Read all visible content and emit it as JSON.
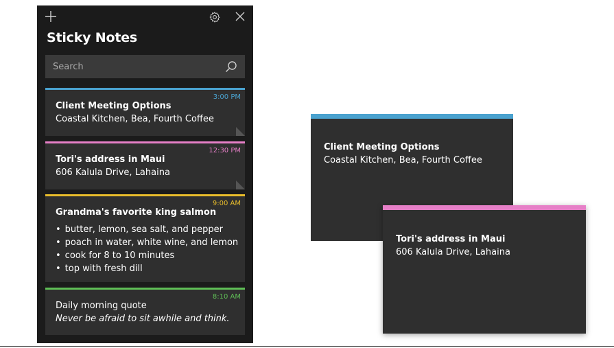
{
  "app": {
    "title": "Sticky Notes"
  },
  "search": {
    "placeholder": "Search",
    "value": ""
  },
  "colors": {
    "blue": "#4aa2cf",
    "pink": "#e67fc7",
    "yellow": "#e9bd2b",
    "green": "#5fbf56",
    "panel_bg": "#1b1b1b",
    "card_bg": "#2f2f2f"
  },
  "icons": {
    "add": "plus-icon",
    "settings": "gear-icon",
    "close": "close-icon",
    "search": "search-icon"
  },
  "notes": [
    {
      "time": "3:00 PM",
      "title": "Client Meeting Options",
      "text": "Coastal Kitchen, Bea, Fourth Coffee",
      "color": "blue"
    },
    {
      "time": "12:30 PM",
      "title": "Tori's address in Maui",
      "text": "606 Kalula Drive, Lahaina",
      "color": "pink"
    },
    {
      "time": "9:00 AM",
      "title": "Grandma's favorite king salmon",
      "bullets": [
        "butter, lemon, sea salt, and pepper",
        "poach in water, white wine, and lemon",
        "cook for 8 to 10 minutes",
        "top with fresh dill"
      ],
      "color": "yellow"
    },
    {
      "time": "8:10 AM",
      "text": "Daily morning quote",
      "text_italic": "Never be afraid to sit awhile and think.",
      "color": "green"
    }
  ],
  "open_notes": [
    {
      "title": "Client Meeting Options",
      "text": "Coastal Kitchen, Bea, Fourth Coffee",
      "color": "blue"
    },
    {
      "title": "Tori's address in Maui",
      "text": "606 Kalula Drive, Lahaina",
      "color": "pink"
    }
  ]
}
